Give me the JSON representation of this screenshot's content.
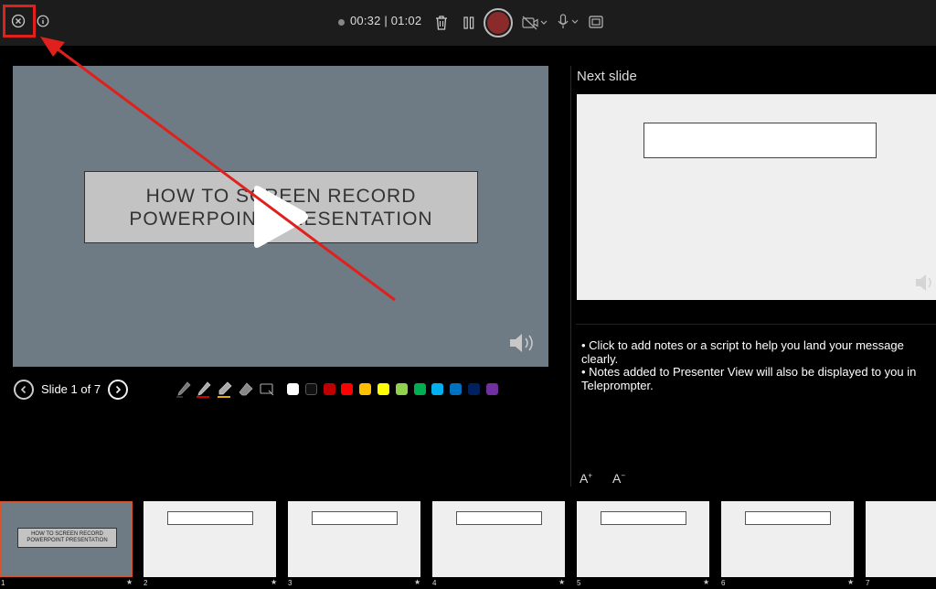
{
  "topbar": {
    "timer_elapsed": "00:32",
    "timer_total": "01:02",
    "icons": [
      "close-icon",
      "info-icon",
      "delete-icon",
      "pause-icon",
      "record-icon",
      "camera-off-icon",
      "microphone-icon",
      "layout-icon"
    ]
  },
  "current_slide": {
    "title_line1": "HOW TO SCREEN RECORD",
    "title_line2": "POWERPOINT PRESENTATION"
  },
  "navigation": {
    "slide_counter": "Slide 1 of 7"
  },
  "ink_colors": [
    "#ffffff",
    "#111111",
    "#c00000",
    "#ff0000",
    "#ffc000",
    "#ffff00",
    "#92d050",
    "#00b050",
    "#00b0f0",
    "#0070c0",
    "#002060",
    "#7030a0"
  ],
  "next_pane": {
    "label": "Next slide"
  },
  "notes": {
    "line1": "• Click to add notes or a script to help you land your message clearly.",
    "line2": "• Notes added to Presenter View will also be displayed to you in Teleprompter."
  },
  "font_controls": {
    "increase": "A",
    "decrease": "A"
  },
  "filmstrip": {
    "thumb1_title": "HOW TO SCREEN RECORD POWERPOINT PRESENTATION",
    "numbers": [
      "1",
      "2",
      "3",
      "4",
      "5",
      "6",
      "7"
    ]
  },
  "colors": {
    "accent_annotation": "#e0201c",
    "selected_thumb_border": "#d9532b",
    "slide_bg": "#6e7b84"
  }
}
